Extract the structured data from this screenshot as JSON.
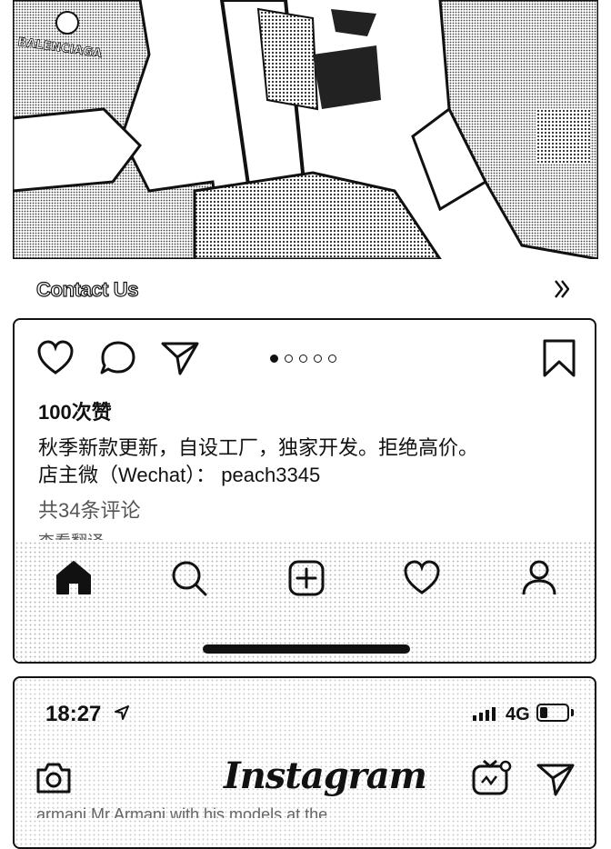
{
  "post_image": {
    "brand_text": "BALENCIAGA"
  },
  "contact": {
    "label": "Contact Us",
    "chevron_icon": "double-chevron-right-icon"
  },
  "post": {
    "actions": {
      "like_icon": "heart-icon",
      "comment_icon": "comment-bubble-icon",
      "share_icon": "send-icon",
      "save_icon": "bookmark-icon"
    },
    "carousel": {
      "count": 5,
      "active_index": 0
    },
    "likes": "100次赞",
    "caption_line1": "秋季新款更新，自设工厂，独家开发。拒绝高价。",
    "caption_line2": "店主微（Wechat）：  peach3345",
    "comments_link": "共34条评论",
    "translate": "查看翻译"
  },
  "tabbar": {
    "items": [
      {
        "icon": "home-icon",
        "active": true
      },
      {
        "icon": "search-icon"
      },
      {
        "icon": "add-post-icon"
      },
      {
        "icon": "heart-icon"
      },
      {
        "icon": "profile-icon"
      }
    ]
  },
  "status_bar": {
    "time": "18:27",
    "network": "4G",
    "battery_level": 0.25
  },
  "instagram_header": {
    "logo": "Instagram",
    "camera_icon": "camera-icon",
    "igtv_icon": "igtv-icon",
    "direct_icon": "send-icon"
  },
  "cut_text": "armani Mr Armani with his models at the"
}
